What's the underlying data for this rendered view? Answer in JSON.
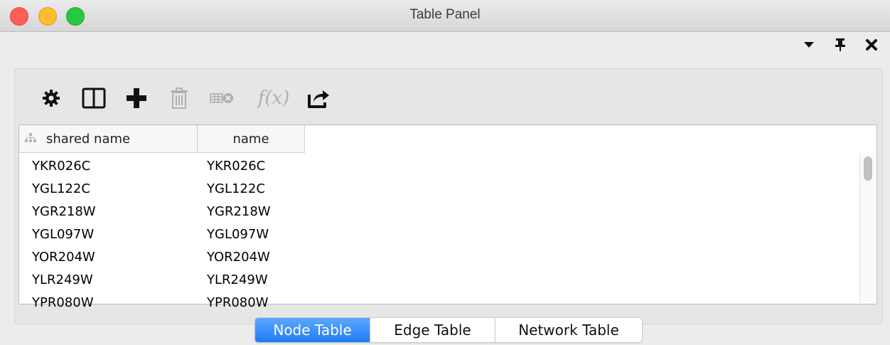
{
  "window": {
    "title": "Table Panel"
  },
  "toolbar": {
    "icons": [
      "gear-icon",
      "columns-icon",
      "plus-icon",
      "trash-icon",
      "delete-table-icon",
      "function-icon",
      "export-icon"
    ],
    "fx_label": "f(x)"
  },
  "table": {
    "columns": [
      "shared name",
      "name"
    ],
    "rows": [
      [
        "YKR026C",
        "YKR026C"
      ],
      [
        "YGL122C",
        "YGL122C"
      ],
      [
        "YGR218W",
        "YGR218W"
      ],
      [
        "YGL097W",
        "YGL097W"
      ],
      [
        "YOR204W",
        "YOR204W"
      ],
      [
        "YLR249W",
        "YLR249W"
      ],
      [
        "YPR080W",
        "YPR080W"
      ]
    ]
  },
  "tabs": [
    {
      "label": "Node Table",
      "active": true
    },
    {
      "label": "Edge Table",
      "active": false
    },
    {
      "label": "Network Table",
      "active": false
    }
  ],
  "colors": {
    "active_tab": "#1e7cf2",
    "disabled_icon": "#b0b0b0"
  }
}
